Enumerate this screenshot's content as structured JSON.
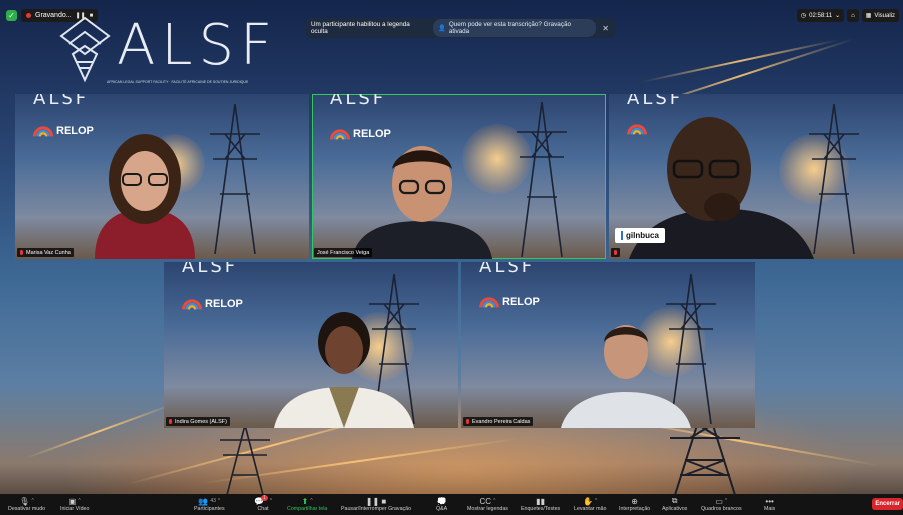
{
  "recording": {
    "label": "Gravando...",
    "pause": "❚❚",
    "stop": "■"
  },
  "banner": {
    "text": "Um participante habilitou a legenda oculta",
    "chip": "Quem pode ver esta transcrição? Gravação ativada",
    "close": "✕"
  },
  "topright": {
    "timer": "02:58:11",
    "view_label": "Visualiz"
  },
  "logo": {
    "text": "ALSF",
    "subtitle": "AFRICAN LEGAL SUPPORT FACILITY · FACILITÉ AFRICAINE DE SOUTIEN JURIDIQUE"
  },
  "tile_brand": {
    "alsf": "ALSF",
    "relop": "RELOP"
  },
  "participants": [
    {
      "name": "Marisa Vaz Cunha"
    },
    {
      "name": "José Francisco Veiga",
      "active": true
    },
    {
      "name": "gilnbuca"
    },
    {
      "name": "Indira Gomes (ALSF)"
    },
    {
      "name": "Evandro Pereira Caldas"
    }
  ],
  "toolbar": {
    "items": [
      {
        "label": "Desativar mudo",
        "icon": "microphone-icon"
      },
      {
        "label": "Iniciar Vídeo",
        "icon": "video-icon"
      },
      {
        "label": "Participantes",
        "icon": "participants-icon",
        "count": "43"
      },
      {
        "label": "Chat",
        "icon": "chat-icon",
        "badge": "1"
      },
      {
        "label": "Compartilhar tela",
        "icon": "share-screen-icon"
      },
      {
        "label": "Pausar/Interromper Gravação",
        "icon": "pause-record-icon"
      },
      {
        "label": "Q&A",
        "icon": "qa-icon"
      },
      {
        "label": "Mostrar legendas",
        "icon": "cc-icon"
      },
      {
        "label": "Enquetes/Testes",
        "icon": "polls-icon"
      },
      {
        "label": "Levantar mão",
        "icon": "raise-hand-icon"
      },
      {
        "label": "Interpretação",
        "icon": "globe-icon"
      },
      {
        "label": "Aplicativos",
        "icon": "apps-icon"
      },
      {
        "label": "Quadros brancos",
        "icon": "whiteboard-icon"
      },
      {
        "label": "Mais",
        "icon": "more-icon"
      }
    ],
    "end": "Encerrar"
  },
  "colors": {
    "accent_green": "#35c759",
    "record_red": "#e5383b",
    "end_red": "#d9262c"
  }
}
